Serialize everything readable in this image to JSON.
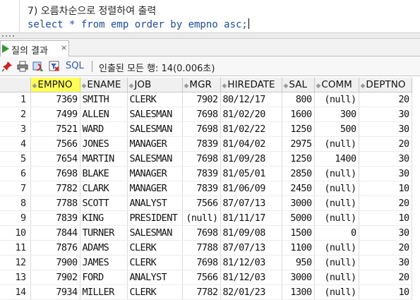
{
  "editor": {
    "comment_line": "7) 오름차순으로 정렬하여 출력",
    "sql_line": "select * from emp order by empno asc;"
  },
  "tab": {
    "label": "질의 결과",
    "close": "×"
  },
  "toolbar": {
    "sql_label": "SQL",
    "status": "인출된 모든 행: 14(0.006초)"
  },
  "grid": {
    "columns": [
      "EMPNO",
      "ENAME",
      "JOB",
      "MGR",
      "HIREDATE",
      "SAL",
      "COMM",
      "DEPTNO"
    ],
    "sorted_column": "EMPNO",
    "highlight_color": "#ffff55",
    "rows": [
      [
        "1",
        "7369",
        "SMITH",
        "CLERK",
        "7902",
        "80/12/17",
        "800",
        "(null)",
        "20"
      ],
      [
        "2",
        "7499",
        "ALLEN",
        "SALESMAN",
        "7698",
        "81/02/20",
        "1600",
        "300",
        "30"
      ],
      [
        "3",
        "7521",
        "WARD",
        "SALESMAN",
        "7698",
        "81/02/22",
        "1250",
        "500",
        "30"
      ],
      [
        "4",
        "7566",
        "JONES",
        "MANAGER",
        "7839",
        "81/04/02",
        "2975",
        "(null)",
        "20"
      ],
      [
        "5",
        "7654",
        "MARTIN",
        "SALESMAN",
        "7698",
        "81/09/28",
        "1250",
        "1400",
        "30"
      ],
      [
        "6",
        "7698",
        "BLAKE",
        "MANAGER",
        "7839",
        "81/05/01",
        "2850",
        "(null)",
        "30"
      ],
      [
        "7",
        "7782",
        "CLARK",
        "MANAGER",
        "7839",
        "81/06/09",
        "2450",
        "(null)",
        "10"
      ],
      [
        "8",
        "7788",
        "SCOTT",
        "ANALYST",
        "7566",
        "87/07/13",
        "3000",
        "(null)",
        "20"
      ],
      [
        "9",
        "7839",
        "KING",
        "PRESIDENT",
        "(null)",
        "81/11/17",
        "5000",
        "(null)",
        "10"
      ],
      [
        "10",
        "7844",
        "TURNER",
        "SALESMAN",
        "7698",
        "81/09/08",
        "1500",
        "0",
        "30"
      ],
      [
        "11",
        "7876",
        "ADAMS",
        "CLERK",
        "7788",
        "87/07/13",
        "1100",
        "(null)",
        "20"
      ],
      [
        "12",
        "7900",
        "JAMES",
        "CLERK",
        "7698",
        "81/12/03",
        "950",
        "(null)",
        "30"
      ],
      [
        "13",
        "7902",
        "FORD",
        "ANALYST",
        "7566",
        "81/12/03",
        "3000",
        "(null)",
        "20"
      ],
      [
        "14",
        "7934",
        "MILLER",
        "CLERK",
        "7782",
        "82/01/23",
        "1300",
        "(null)",
        "10"
      ]
    ]
  },
  "icons": {
    "tab": "run-result-icon",
    "toolbar": [
      "pin-icon",
      "print-icon",
      "refresh-icon",
      "filter-icon"
    ]
  }
}
